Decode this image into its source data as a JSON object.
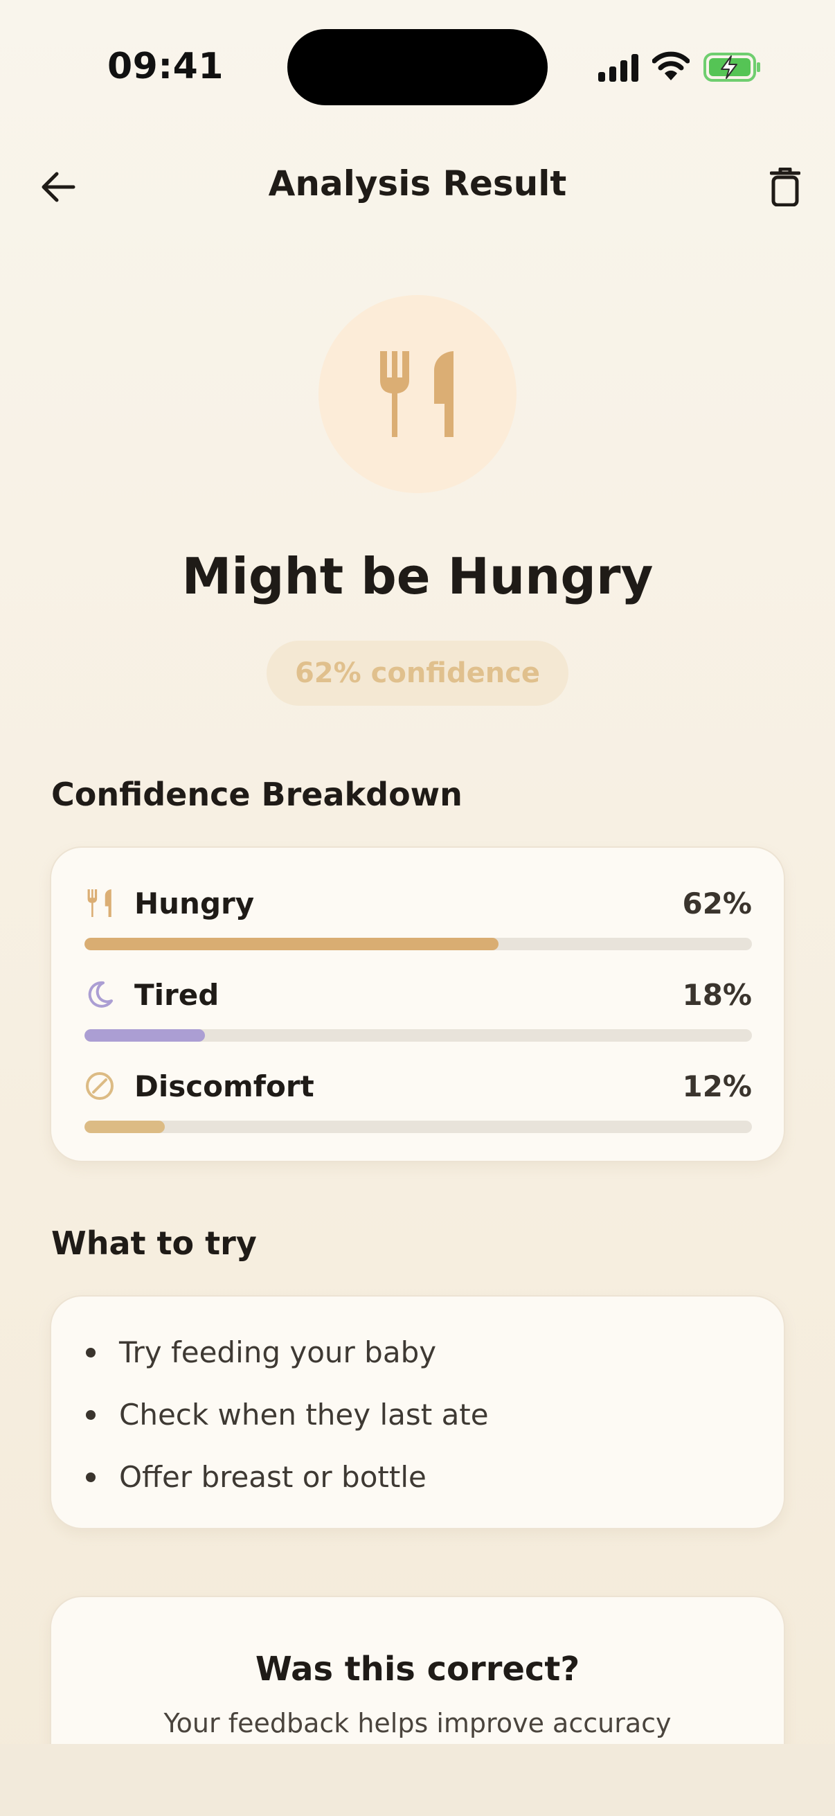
{
  "status_bar": {
    "time": "09:41"
  },
  "header": {
    "title": "Analysis Result"
  },
  "result": {
    "title": "Might be Hungry",
    "confidence_label": "62% confidence",
    "icon": "fork-knife-icon",
    "accent_color": "#d9ad72"
  },
  "breakdown": {
    "title": "Confidence Breakdown",
    "items": [
      {
        "label": "Hungry",
        "value_text": "62%",
        "value": 0.62,
        "color": "#d9ad72",
        "icon": "fork-knife-icon"
      },
      {
        "label": "Tired",
        "value_text": "18%",
        "value": 0.18,
        "color": "#ab9ed3",
        "icon": "moon-icon"
      },
      {
        "label": "Discomfort",
        "value_text": "12%",
        "value": 0.12,
        "color": "#dcbb84",
        "icon": "discomfort-icon"
      }
    ]
  },
  "tips": {
    "title": "What to try",
    "items": [
      "Try feeding your baby",
      "Check when they last ate",
      "Offer breast or bottle"
    ]
  },
  "feedback": {
    "title": "Was this correct?",
    "subtitle": "Your feedback helps improve accuracy"
  }
}
